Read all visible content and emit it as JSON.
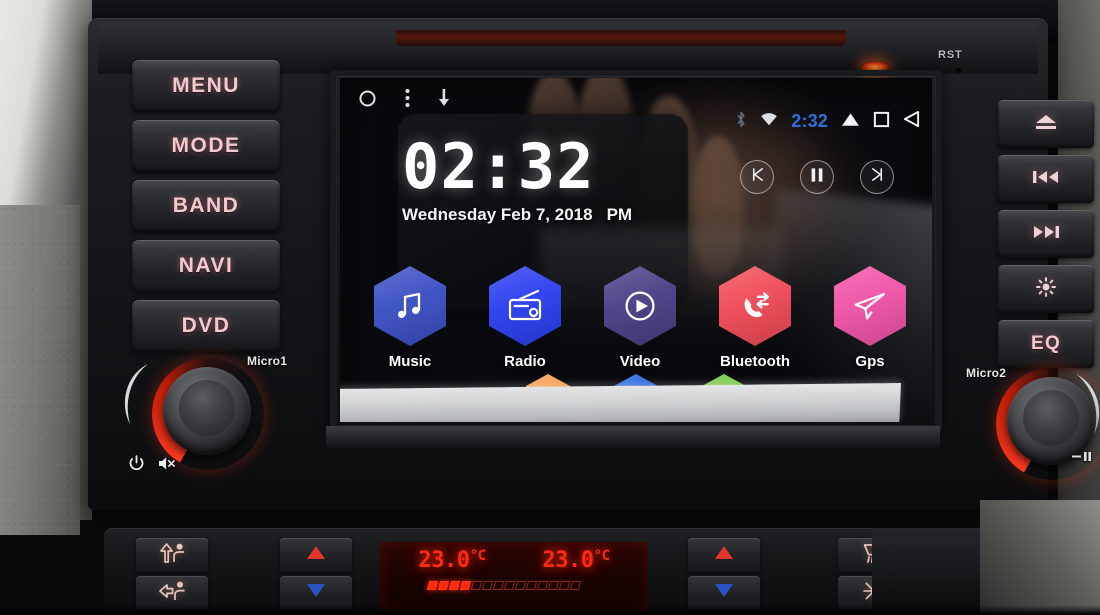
{
  "device": {
    "reset_label": "RST",
    "left_mic_label": "Micro1",
    "right_mic_label": "Micro2"
  },
  "left_buttons": [
    {
      "label": "MENU",
      "name": "menu-button"
    },
    {
      "label": "MODE",
      "name": "mode-button"
    },
    {
      "label": "BAND",
      "name": "band-button"
    },
    {
      "label": "NAVI",
      "name": "navi-button"
    },
    {
      "label": "DVD",
      "name": "dvd-button"
    }
  ],
  "right_buttons": [
    {
      "label": "",
      "icon": "eject-icon",
      "name": "eject-button"
    },
    {
      "label": "",
      "icon": "previous-track-icon",
      "name": "previous-track-button"
    },
    {
      "label": "",
      "icon": "next-track-icon",
      "name": "next-track-button"
    },
    {
      "label": "",
      "icon": "brightness-icon",
      "name": "brightness-button"
    },
    {
      "label": "EQ",
      "icon": "",
      "name": "eq-button"
    }
  ],
  "knob_icons": {
    "power": "power-icon",
    "mute": "mute-icon",
    "play_pause": "play-pause-icon"
  },
  "screen": {
    "overlay_icons": [
      "circle-icon",
      "overflow-menu-icon",
      "download-arrow-icon"
    ],
    "statusbar": {
      "bluetooth": "bluetooth-icon",
      "wifi": "wifi-icon",
      "time": "2:32",
      "nav_recent": "triangle-up-icon",
      "nav_home": "square-icon",
      "nav_back": "back-triangle-icon",
      "time_color": "#2f6fd8"
    },
    "clock": {
      "time": "02:32",
      "date": "Wednesday Feb 7, 2018",
      "ampm": "PM"
    },
    "transport": [
      {
        "name": "previous-button",
        "icon": "skip-previous-icon"
      },
      {
        "name": "pause-button",
        "icon": "pause-icon"
      },
      {
        "name": "next-button",
        "icon": "skip-next-icon"
      }
    ],
    "apps": [
      {
        "label": "Music",
        "icon": "music-note-icon",
        "color": "#3b4fc4",
        "name": "app-music"
      },
      {
        "label": "Radio",
        "icon": "radio-icon",
        "color": "#2b3ff0",
        "name": "app-radio"
      },
      {
        "label": "Video",
        "icon": "play-circle-icon",
        "color": "#4a3f86",
        "name": "app-video"
      },
      {
        "label": "Bluetooth",
        "icon": "phone-call-icon",
        "color": "#f04a57",
        "name": "app-bluetooth"
      },
      {
        "label": "Gps",
        "icon": "paper-plane-icon",
        "color": "#f053a8",
        "name": "app-gps"
      }
    ],
    "dock": [
      {
        "icon": "apps-icon",
        "color": "#f79a4b",
        "name": "dock-apps"
      },
      {
        "icon": "home-icon",
        "color": "#1f5fe0",
        "name": "dock-home"
      },
      {
        "icon": "settings-icon",
        "color": "#6fc63c",
        "name": "dock-settings"
      }
    ]
  },
  "climate": {
    "temp_left": "23.0",
    "temp_right": "23.0",
    "unit": "°C",
    "fan_segments_on": 4,
    "fan_segments_total": 14,
    "buttons": [
      {
        "icon": "airflow-face-icon",
        "name": "airflow-face-button"
      },
      {
        "icon": "airflow-feet-icon",
        "name": "airflow-feet-button"
      },
      {
        "icon": "temp-up-icon",
        "name": "temp-left-up-button"
      },
      {
        "icon": "temp-down-icon",
        "name": "temp-left-down-button"
      },
      {
        "icon": "temp-up-icon",
        "name": "temp-right-up-button"
      },
      {
        "icon": "temp-down-icon",
        "name": "temp-right-down-button"
      },
      {
        "icon": "rear-defrost-icon",
        "name": "rear-defrost-button"
      },
      {
        "icon": "ac-snowflake-icon",
        "name": "ac-button"
      }
    ],
    "lcd_color": "#ff2a10"
  }
}
